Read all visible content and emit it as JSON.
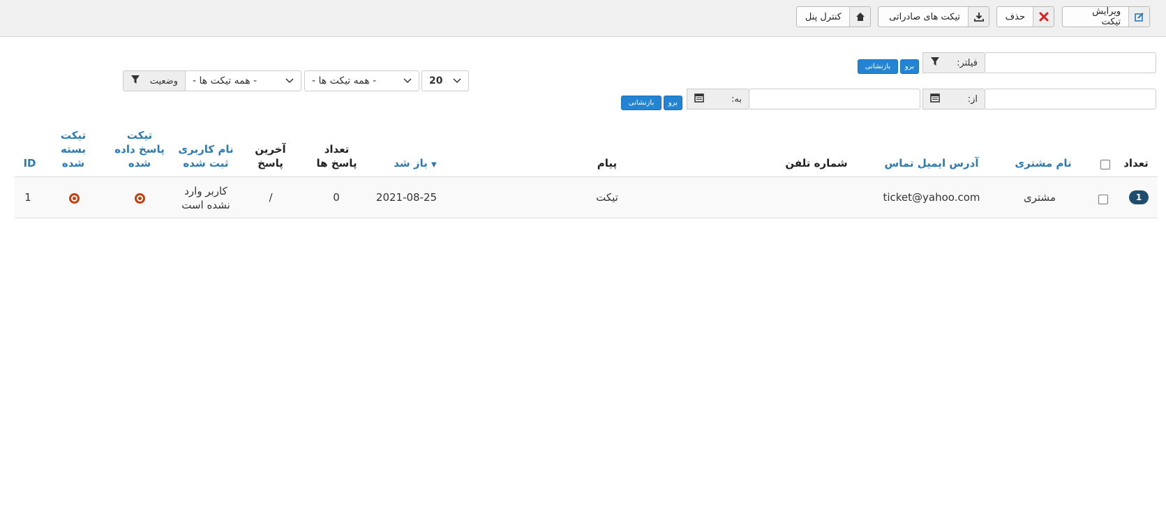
{
  "toolbar": {
    "edit_ticket": "ویرایش تیکت",
    "delete": "حذف",
    "export_tickets": "تیکت های صادراتی",
    "control_panel": "کنترل پنل"
  },
  "filters": {
    "filter_label": "فیلتر:",
    "from_label": "از:",
    "to_label": "به:",
    "go_label": "برو",
    "reset_label": "بازنشانی",
    "status_label": "وضعیت",
    "tickets_select_1": "- همه تیکت ها -",
    "tickets_select_2": "- همه تیکت ها -",
    "page_size": "20"
  },
  "table": {
    "headers": {
      "count": "تعداد",
      "customer_name": "نام مشتری",
      "email": "آدرس ایمیل تماس",
      "phone": "شماره تلفن",
      "message": "پیام",
      "opened": "باز شد",
      "reply_count_1": "تعداد",
      "reply_count_2": "پاسخ ها",
      "last_reply_1": "آخرین",
      "last_reply_2": "پاسخ",
      "username_1": "نام کاربری",
      "username_2": "ثبت شده",
      "answered_1": "تیکت",
      "answered_2": "پاسخ داده",
      "answered_3": "شده",
      "closed_1": "تیکت",
      "closed_2": "بسته",
      "closed_3": "شده",
      "id": "ID"
    },
    "rows": [
      {
        "count": "1",
        "customer_name": "مشتری",
        "email": "ticket@yahoo.com",
        "phone": "",
        "message": "تیکت",
        "opened": "2021-08-25",
        "reply_count": "0",
        "last_reply": "/",
        "username_1": "کاربر وارد",
        "username_2": "نشده است",
        "id": "1"
      }
    ]
  },
  "colors": {
    "link": "#2a7ab8",
    "primary_button": "#2384d3",
    "delete_icon": "#e01b1b",
    "badge": "#1e4e6b",
    "status_icon": "#c0400f"
  },
  "icons": {
    "edit": "edit-icon",
    "delete": "close-icon",
    "export": "download-icon",
    "control_panel": "home-icon",
    "filter": "filter-icon",
    "calendar": "calendar-icon",
    "sort": "sort-desc-icon"
  }
}
